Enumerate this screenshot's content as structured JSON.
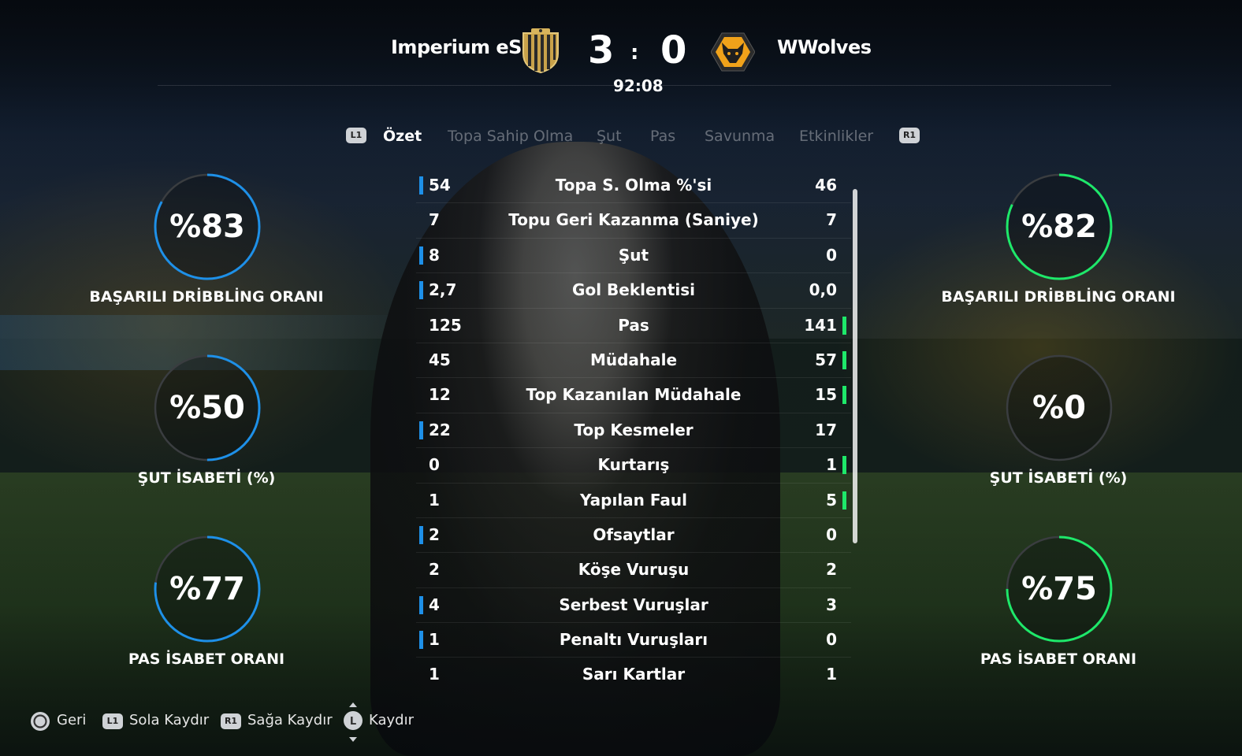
{
  "header": {
    "home_team": "Imperium eSp",
    "away_team": "WWolves",
    "home_score": "3",
    "away_score": "0",
    "separator": ":",
    "clock": "92:08",
    "home_crest": "striped-shield-crest",
    "away_crest": "wolf-head-crest"
  },
  "tabs": {
    "left_button": "L1",
    "right_button": "R1",
    "items": [
      "Özet",
      "Topa Sahip Olma",
      "Şut",
      "Pas",
      "Savunma",
      "Etkinlikler"
    ],
    "active": "Özet"
  },
  "left_rings": [
    {
      "value": "%83",
      "label": "BAŞARILI DRİBBLİNG ORANI",
      "fraction": 0.83
    },
    {
      "value": "%50",
      "label": "ŞUT İSABETİ (%)",
      "fraction": 0.5
    },
    {
      "value": "%77",
      "label": "PAS İSABET ORANI",
      "fraction": 0.77
    }
  ],
  "right_rings": [
    {
      "value": "%82",
      "label": "BAŞARILI DRİBBLİNG ORANI",
      "fraction": 0.82
    },
    {
      "value": "%0",
      "label": "ŞUT İSABETİ (%)",
      "fraction": 0.0
    },
    {
      "value": "%75",
      "label": "PAS İSABET ORANI",
      "fraction": 0.75
    }
  ],
  "colors": {
    "home_accent": "#1e90e8",
    "away_accent": "#1ee86a",
    "ring_track": "#3a3d40"
  },
  "stats": [
    {
      "home": "54",
      "name": "Topa S. Olma %'si",
      "away": "46",
      "lead": "home"
    },
    {
      "home": "7",
      "name": "Topu Geri Kazanma (Saniye)",
      "away": "7",
      "lead": "none"
    },
    {
      "home": "8",
      "name": "Şut",
      "away": "0",
      "lead": "home"
    },
    {
      "home": "2,7",
      "name": "Gol Beklentisi",
      "away": "0,0",
      "lead": "home"
    },
    {
      "home": "125",
      "name": "Pas",
      "away": "141",
      "lead": "away"
    },
    {
      "home": "45",
      "name": "Müdahale",
      "away": "57",
      "lead": "away"
    },
    {
      "home": "12",
      "name": "Top Kazanılan Müdahale",
      "away": "15",
      "lead": "away"
    },
    {
      "home": "22",
      "name": "Top Kesmeler",
      "away": "17",
      "lead": "home"
    },
    {
      "home": "0",
      "name": "Kurtarış",
      "away": "1",
      "lead": "away"
    },
    {
      "home": "1",
      "name": "Yapılan Faul",
      "away": "5",
      "lead": "away"
    },
    {
      "home": "2",
      "name": "Ofsaytlar",
      "away": "0",
      "lead": "home"
    },
    {
      "home": "2",
      "name": "Köşe Vuruşu",
      "away": "2",
      "lead": "none"
    },
    {
      "home": "4",
      "name": "Serbest Vuruşlar",
      "away": "3",
      "lead": "home"
    },
    {
      "home": "1",
      "name": "Penaltı Vuruşları",
      "away": "0",
      "lead": "home"
    },
    {
      "home": "1",
      "name": "Sarı Kartlar",
      "away": "1",
      "lead": "none"
    }
  ],
  "footer": {
    "back_label": "Geri",
    "l1_icon": "L1",
    "left_scroll_label": "Sola Kaydır",
    "r1_icon": "R1",
    "right_scroll_label": "Sağa Kaydır",
    "l_stick_icon": "L",
    "scroll_label": "Kaydır"
  }
}
